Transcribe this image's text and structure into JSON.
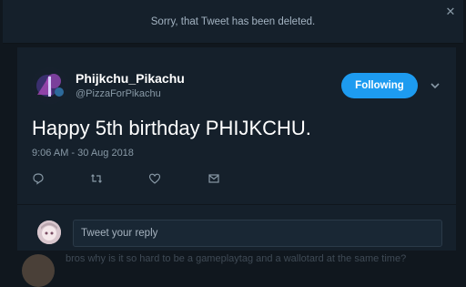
{
  "banner": {
    "message": "Sorry, that Tweet has been deleted."
  },
  "tweet": {
    "display_name": "Phijkchu_Pikachu",
    "handle": "@PizzaForPikachu",
    "follow_label": "Following",
    "text": "Happy 5th birthday PHIJKCHU.",
    "timestamp": "9:06 AM - 30 Aug 2018",
    "actions": [
      "reply-icon",
      "retweet-icon",
      "like-icon",
      "message-icon"
    ]
  },
  "reply": {
    "placeholder": "Tweet your reply"
  },
  "background_tweet": {
    "text": "bros why is it so hard to be a gameplaytag and a wallotard at the same time?"
  },
  "colors": {
    "accent": "#1d9bf0",
    "card": "#15202b",
    "muted": "#8899a6"
  }
}
